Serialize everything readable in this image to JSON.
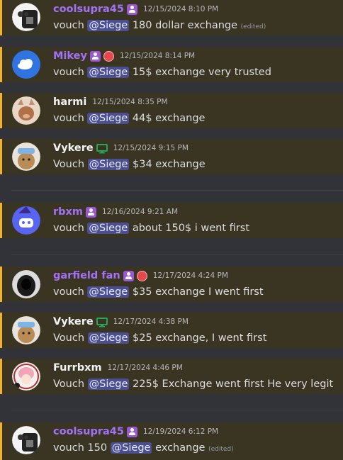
{
  "messages": [
    {
      "username": "coolsupra45",
      "name_color": "#a371f7",
      "timestamp": "12/15/2024 8:10 PM",
      "badges": [
        "role-badge"
      ],
      "avatar": "ghost-avatar",
      "text_before": "vouch",
      "mention": "@Siege",
      "text_after": "180 dollar exchange",
      "edited": "(edited)"
    },
    {
      "username": "Mikey",
      "name_color": "#a371f7",
      "timestamp": "12/15/2024 8:14 PM",
      "badges": [
        "role-badge",
        "globe-icon"
      ],
      "avatar": "cloudflare-avatar",
      "text_before": "vouch",
      "mention": "@Siege",
      "text_after": "15$ exchange very trusted",
      "edited": ""
    },
    {
      "username": "harmi",
      "name_color": "#f2f3f5",
      "timestamp": "12/15/2024 8:35 PM",
      "badges": [],
      "avatar": "cat-avatar",
      "text_before": "vouch",
      "mention": "@Siege",
      "text_after": "44$ exchange",
      "edited": ""
    },
    {
      "username": "Vykere",
      "name_color": "#f2f3f5",
      "timestamp": "12/15/2024 9:15 PM",
      "badges": [
        "monitor-icon"
      ],
      "avatar": "dog-avatar",
      "text_before": "Vouch",
      "mention": "@Siege",
      "text_after": "$34 exchange",
      "edited": ""
    },
    {
      "username": "rbxm",
      "name_color": "#a371f7",
      "timestamp": "12/16/2024 9:21 AM",
      "badges": [
        "role-badge"
      ],
      "avatar": "discord-wizard-avatar",
      "text_before": "vouch",
      "mention": "@Siege",
      "text_after": "about 150$ i went first",
      "edited": ""
    },
    {
      "username": "garfield fan",
      "name_color": "#a371f7",
      "timestamp": "12/17/2024 4:24 PM",
      "badges": [
        "role-badge",
        "globe-icon"
      ],
      "avatar": "hooded-avatar",
      "text_before": "vouch",
      "mention": "@Siege",
      "text_after": "$35 exchange I went first",
      "edited": ""
    },
    {
      "username": "Vykere",
      "name_color": "#f2f3f5",
      "timestamp": "12/17/2024 4:38 PM",
      "badges": [
        "monitor-icon"
      ],
      "avatar": "dog-avatar",
      "text_before": "Vouch",
      "mention": "@Siege",
      "text_after": "$25 exchange, I went first",
      "edited": ""
    },
    {
      "username": "Furrbxm",
      "name_color": "#f2f3f5",
      "timestamp": "12/17/2024 4:46 PM",
      "badges": [],
      "avatar": "anime-avatar",
      "text_before": "Vouch",
      "mention": "@Siege",
      "text_after": "225$ Exchange went first He very legit",
      "edited": ""
    },
    {
      "username": "coolsupra45",
      "name_color": "#a371f7",
      "timestamp": "12/19/2024 6:12 PM",
      "badges": [
        "role-badge"
      ],
      "avatar": "ghost-avatar",
      "text_before": "vouch 150",
      "mention": "@Siege",
      "text_after": "exchange",
      "edited": "(edited)"
    }
  ]
}
